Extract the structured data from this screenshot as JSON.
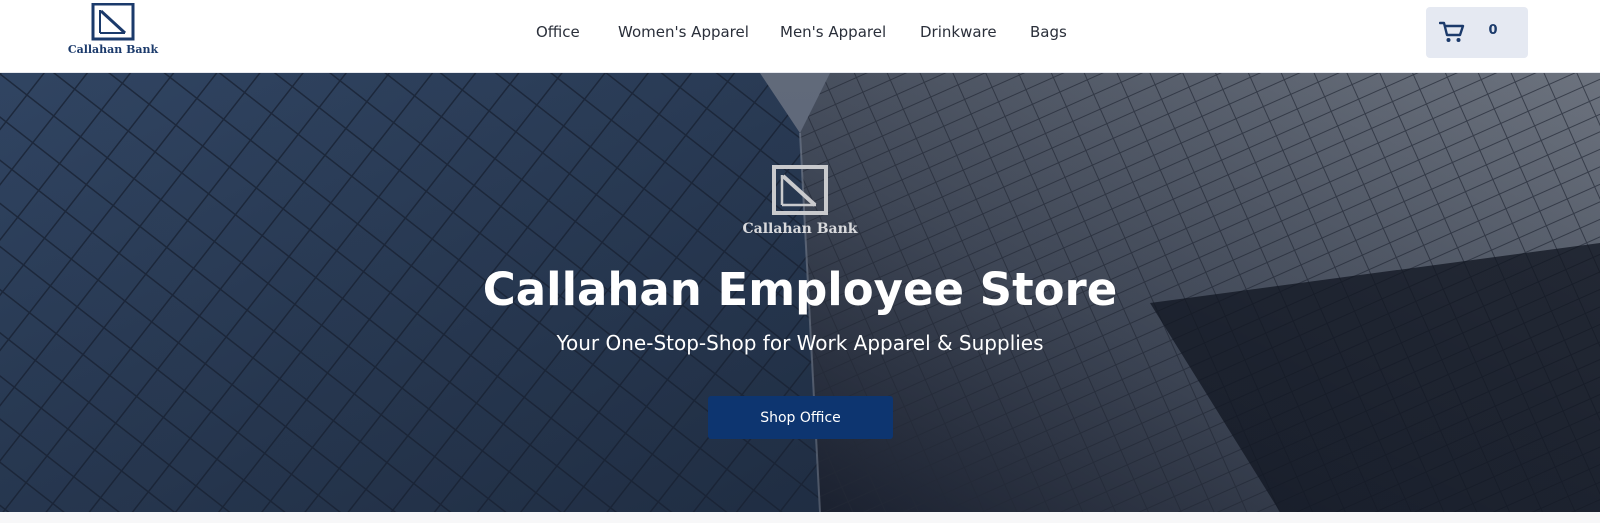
{
  "brand": {
    "name": "Callahan Bank",
    "logo_icon": "bank-logo-icon",
    "color": "#1b3a6b"
  },
  "nav": {
    "items": [
      {
        "label": "Office"
      },
      {
        "label": "Women's Apparel"
      },
      {
        "label": "Men's Apparel"
      },
      {
        "label": "Drinkware"
      },
      {
        "label": "Bags"
      }
    ]
  },
  "cart": {
    "icon": "shopping-cart-icon",
    "count": "0"
  },
  "hero": {
    "logo_text": "Callahan Bank",
    "title": "Callahan Employee Store",
    "subtitle": "Your One-Stop-Shop for Work Apparel & Supplies",
    "button_label": "Shop Office",
    "button_color": "#0d3570"
  }
}
